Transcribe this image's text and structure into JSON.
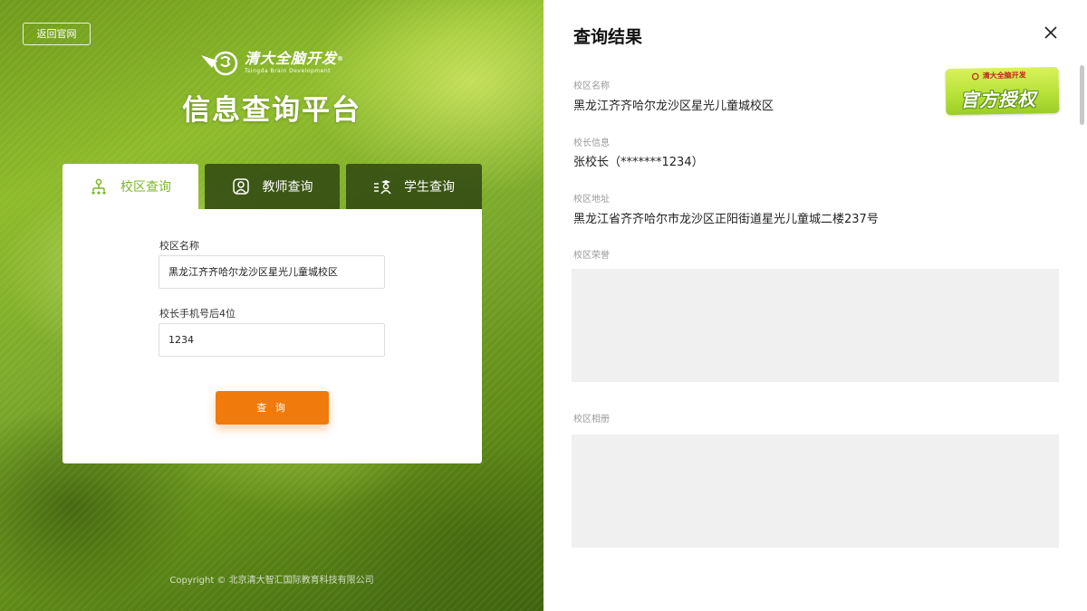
{
  "left": {
    "back_label": "返回官网",
    "logo": {
      "brand_cn": "清大全脑开发",
      "brand_en": "Tsingda Brain Development",
      "reg_mark": "®"
    },
    "platform_title": "信息查询平台",
    "tabs": [
      {
        "label": "校区查询",
        "active": true,
        "icon": "campus-icon"
      },
      {
        "label": "教师查询",
        "active": false,
        "icon": "teacher-icon"
      },
      {
        "label": "学生查询",
        "active": false,
        "icon": "student-icon"
      }
    ],
    "form": {
      "campus_name_label": "校区名称",
      "campus_name_value": "黑龙江齐齐哈尔龙沙区星光儿童城校区",
      "phone_label": "校长手机号后4位",
      "phone_value": "1234",
      "submit_label": "查 询"
    },
    "copyright": "Copyright ©  北京清大智汇国际教育科技有限公司"
  },
  "result": {
    "title": "查询结果",
    "badge": {
      "brand": "清大全脑开发",
      "text": "官方授权"
    },
    "fields": [
      {
        "label": "校区名称",
        "value": "黑龙江齐齐哈尔龙沙区星光儿童城校区"
      },
      {
        "label": "校长信息",
        "value": "张校长（*******1234）"
      },
      {
        "label": "校区地址",
        "value": "黑龙江省齐齐哈尔市龙沙区正阳街道星光儿童城二楼237号"
      }
    ],
    "honors_label": "校区荣誉",
    "album_label": "校区相册"
  },
  "colors": {
    "accent_green": "#7cb72a",
    "button_orange": "#f07a0b",
    "tab_dark": "#2c3c0f"
  }
}
